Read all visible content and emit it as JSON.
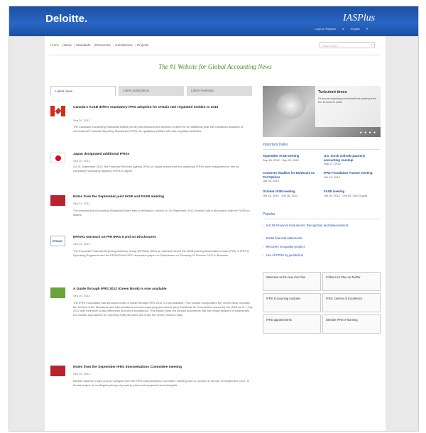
{
  "header": {
    "logo": "Deloitte.",
    "brand": "IASPlus",
    "links": [
      "Login or Register",
      "▸",
      "English",
      "▾"
    ]
  },
  "nav": {
    "items": [
      "Home",
      "News",
      "Standards",
      "Resources",
      "Jurisdictions",
      "Projects"
    ],
    "search_placeholder": "Search IAS..."
  },
  "tagline": "The #1 Website for Global Accounting News",
  "tabs": [
    "Latest news",
    "Latest publications",
    "Latest meetings"
  ],
  "news": [
    {
      "title": "Canada's AcSB defers mandatory IFRS adoption for certain rate regulated entities to 2015",
      "date": "Sep 20, 2012",
      "body": "The Canadian Accounting Standards Board (AcSB) has announced a decision to defer for an additional year the mandatory adoption of International Financial Reporting Standards (IFRSs) for qualifying entities with rate-regulated activities.",
      "flag": "canada"
    },
    {
      "title": "Japan designated additional IFRSs",
      "date": "Sep 20, 2012",
      "body": "On 21 September 2012, the Financial Services Agency (FSA) of Japan announced that additional IFRSs were designated for use by companies voluntarily applying IFRSs in Japan.",
      "flag": "japan"
    },
    {
      "title": "Notes from the September joint IASB and FASB meeting",
      "date": "Sep 21, 2012",
      "body": "The International Accounting Standards Board held a meeting in London on 20 September 2012 of which was a discussion with the FASB on leases.",
      "flag": "notes"
    },
    {
      "title": "EFRAG outreach on PIR IFRS 8 and on Disclosures",
      "date": "Sep 20, 2012",
      "body": "The European Financial Reporting Advisory Group (EFRAG) offers an outreach where the IASB post-implementation review (PIR) of IFRS 8 Operating Segments and the EFRAG/ANC/FRC discussion paper on Disclosures on Thursday 11 October 2012 in Brussels.",
      "flag": "efrag"
    },
    {
      "title": "A Guide through IFRS 2012 (Green Book) is now available",
      "date": "Sep 20, 2012",
      "body": "The IFRS Foundation has announced that 'A Guide through IFRS 2012' is now available. This volume incorporates the 'Green Book' includes the full text of the Standards and Interpretations and accompanying documents (but) that Basis for Conclusions issued by the IASB as of 1 July 2012 with extensive cross-references and other annotations. This edition does not contain documents that are being replaced or superseded but contain approaches for reporting entity directors and enjoy the newer versions early.",
      "flag": "green"
    },
    {
      "title": "Notes from the September IFRS Interpretations Committee meeting",
      "date": "Sep 20, 2012",
      "body": "Deloitte observer notes and our analysis from the IFRS Interpretations Committee meeting held in London on 18 and 19 September 2012. In its last project on contingent pricing of property, plant and equipment and intangible",
      "flag": "notes2"
    }
  ],
  "sidebar": {
    "hero": {
      "title": "Turbulent times",
      "subtitle": "Financial reporting considerations arising from the Eurozone crisis",
      "dots": "● ● ● ●"
    },
    "events_title": "Important Dates",
    "events": [
      {
        "title": "September IASB meeting",
        "date": "Sep 18, 2012 - Sep 20, 2012"
      },
      {
        "title": "U.S. Stock outlook Quarterly accounting roundup",
        "date": "Sep 27, 2012"
      },
      {
        "title": "Comment deadline for ED/2012/3 on Put Options",
        "date": "Oct 01, 2012"
      },
      {
        "title": "IFRS Foundation Trustee meeting",
        "date": "Oct 10, 2012"
      },
      {
        "title": "October IASB meeting",
        "date": "Oct 15, 2012 - Oct 18, 2012"
      },
      {
        "title": "FASB meeting",
        "date": "Oct 20, 2012 - Oct 20, 2012 [Lyon]"
      }
    ],
    "popular_title": "Popular",
    "popular": [
      "IAS 39 Financial Instruments: Recognition and Measurement",
      "Model financial statements",
      "Recovery recognition project",
      "Use of IFRSs by jurisdiction"
    ],
    "boxes": [
      "Welcome to the new IAS Plus",
      "Follow IAS Plus on Twitter",
      "IFRS E-Learning modules",
      "IFRS Centres of Excellence",
      "IFRS appointments",
      "Deloitte IFRS e-learning"
    ]
  },
  "colors": {
    "header": "#1b4fa1",
    "accent": "#4f8b22",
    "link": "#1b4fa1"
  }
}
